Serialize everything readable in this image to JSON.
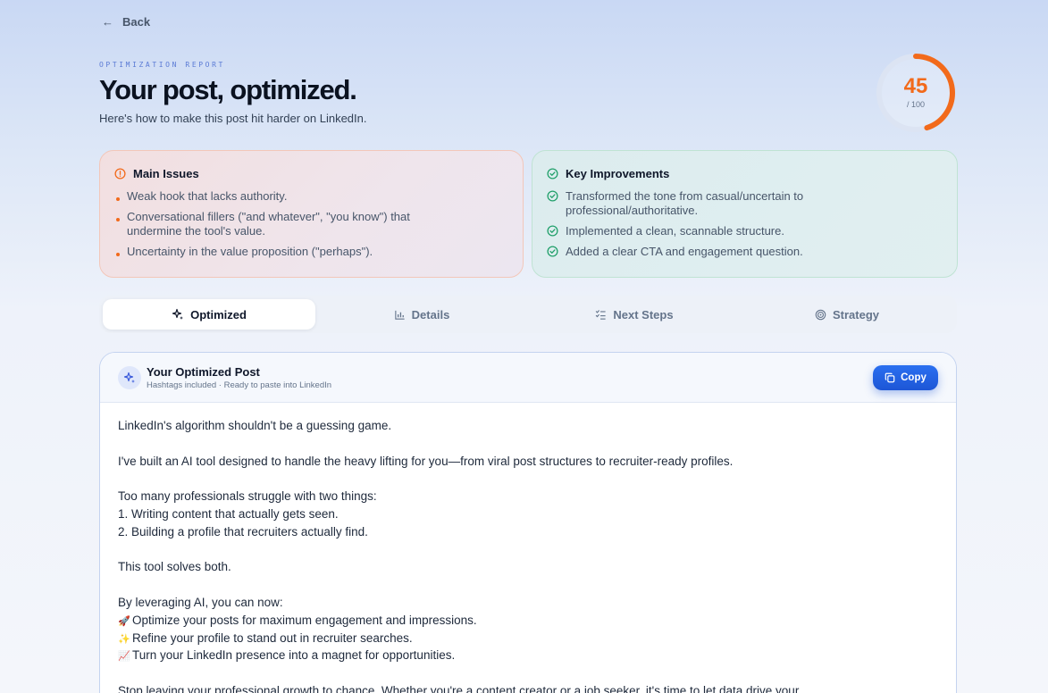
{
  "nav": {
    "back_label": "Back"
  },
  "header": {
    "eyebrow": "OPTIMIZATION REPORT",
    "title": "Your post, optimized.",
    "subtitle": "Here's how to make this post hit harder on LinkedIn."
  },
  "score": {
    "value": "45",
    "max_label": "/ 100",
    "fraction": 0.45,
    "accent": "#f26a1b"
  },
  "issues": {
    "heading": "Main Issues",
    "items": [
      "Weak hook that lacks authority.",
      "Conversational fillers (\"and whatever\", \"you know\") that",
      "undermine the tool's value.",
      "Uncertainty in the value proposition (\"perhaps\")."
    ]
  },
  "improvements": {
    "heading": "Key Improvements",
    "items": [
      "Transformed the tone from casual/uncertain to",
      "professional/authoritative.",
      "Implemented a clean, scannable structure.",
      "Added a clear CTA and engagement question."
    ]
  },
  "tabs": [
    {
      "label": "Optimized",
      "icon": "sparkles-icon"
    },
    {
      "label": "Details",
      "icon": "bar-chart-icon"
    },
    {
      "label": "Next Steps",
      "icon": "checklist-icon"
    },
    {
      "label": "Strategy",
      "icon": "target-icon"
    }
  ],
  "post": {
    "title": "Your Optimized Post",
    "subtitle": "Hashtags included · Ready to paste into LinkedIn",
    "copy_label": "Copy",
    "lines": {
      "l1": "LinkedIn's algorithm shouldn't be a guessing game.",
      "l2": "I've built an AI tool designed to handle the heavy lifting for you—from viral post structures to recruiter-ready profiles.",
      "l3": "Too many professionals struggle with two things:",
      "l4": "1. Writing content that actually gets seen.",
      "l5": "2. Building a profile that recruiters actually find.",
      "l6": "This tool solves both.",
      "l7": "By leveraging AI, you can now:",
      "l8": "Optimize your posts for maximum engagement and impressions.",
      "l9": "Refine your profile to stand out in recruiter searches.",
      "l10": "Turn your LinkedIn presence into a magnet for opportunities.",
      "l11": "Stop leaving your professional growth to chance. Whether you're a content creator or a job seeker, it's time to let data drive your"
    },
    "emoji": {
      "e8": "🚀",
      "e9": "✨",
      "e10": "📈"
    }
  },
  "colors": {
    "accent_orange": "#f26a1b",
    "accent_blue": "#1d56d6",
    "success_green": "#22a06b"
  }
}
